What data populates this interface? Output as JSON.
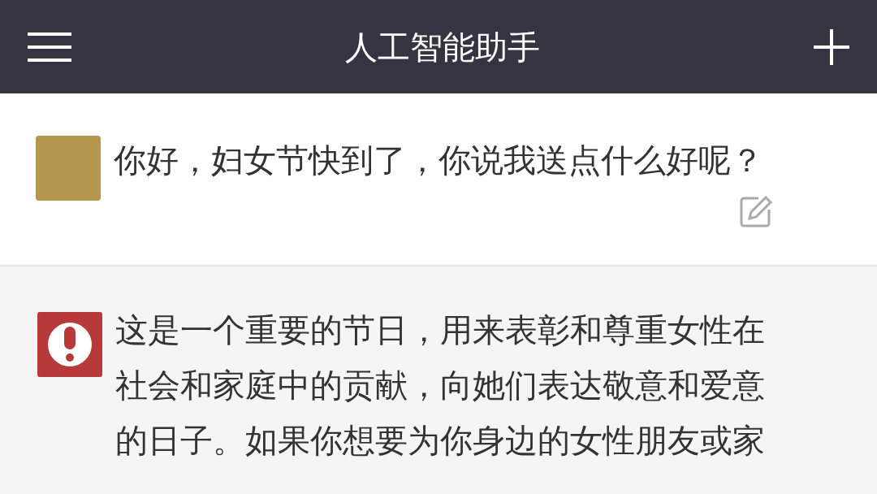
{
  "header": {
    "title": "人工智能助手"
  },
  "messages": [
    {
      "kind": "question",
      "text": "你好，妇女节快到了，你说我送点什么好呢？"
    },
    {
      "kind": "answer",
      "text": "这是一个重要的节日，用来表彰和尊重女性在社会和家庭中的贡献，向她们表达敬意和爱意的日子。如果你想要为你身边的女性朋友或家"
    }
  ]
}
